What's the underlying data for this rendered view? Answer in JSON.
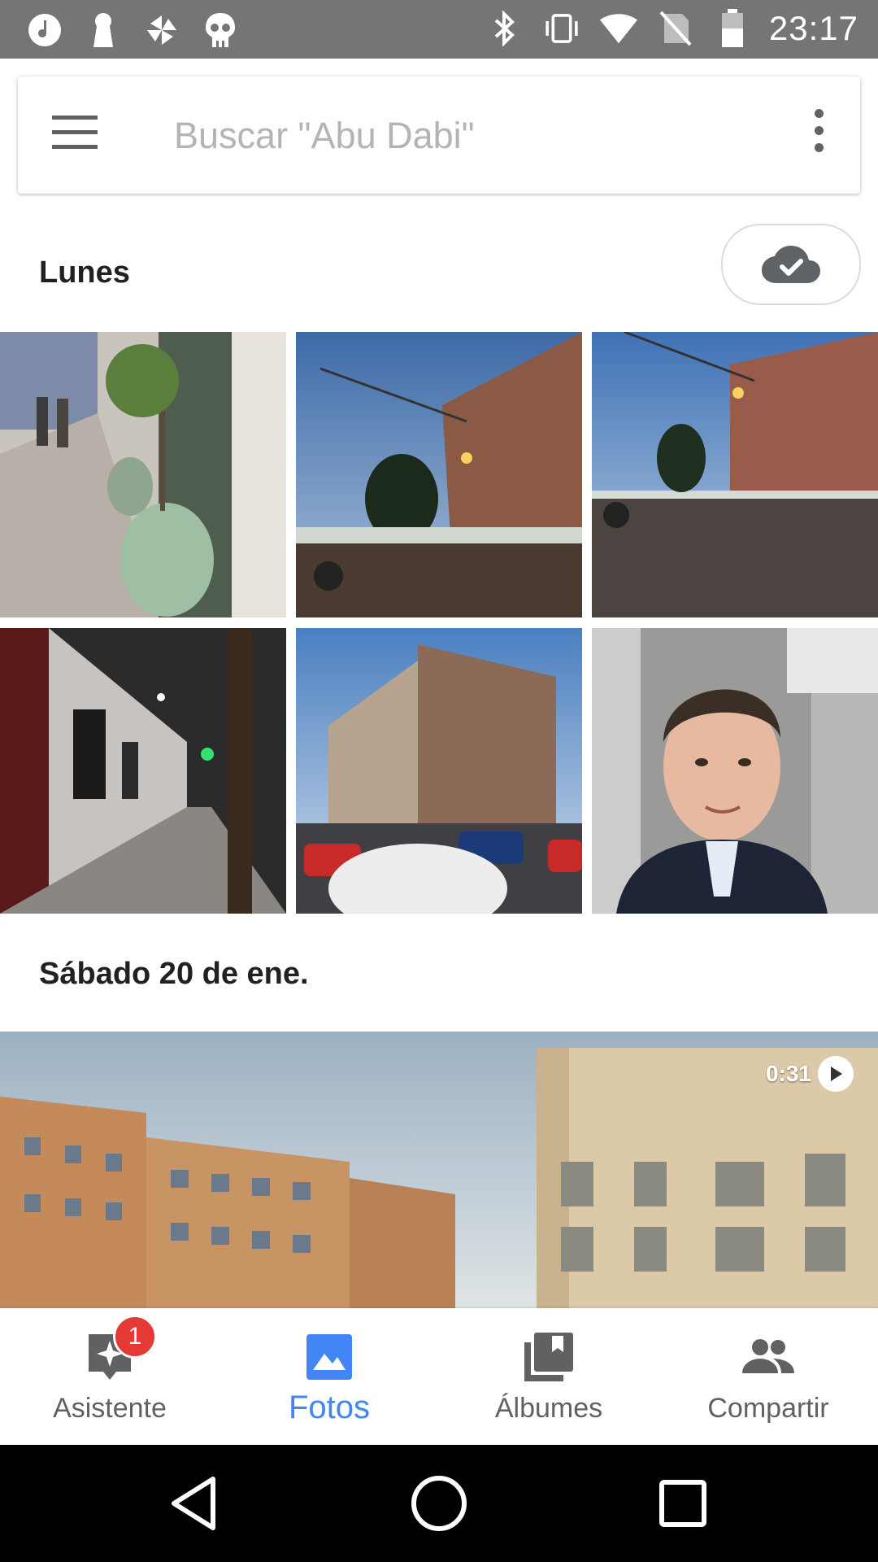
{
  "status_bar": {
    "time": "23:17",
    "left_icons": [
      "music-icon",
      "keyhole-icon",
      "pinwheel-icon",
      "skull-icon"
    ],
    "right_icons": [
      "bluetooth-icon",
      "vibrate-icon",
      "wifi-icon",
      "no-sim-icon",
      "battery-icon"
    ]
  },
  "search": {
    "placeholder": "Buscar \"Abu Dabi\""
  },
  "sections": [
    {
      "title": "Lunes"
    },
    {
      "title": "Sábado 20 de ene."
    }
  ],
  "video": {
    "duration": "0:31"
  },
  "bottom_nav": {
    "items": [
      {
        "label": "Asistente",
        "icon": "assistant-icon",
        "badge": "1",
        "active": false
      },
      {
        "label": "Fotos",
        "icon": "photo-icon",
        "active": true
      },
      {
        "label": "Álbumes",
        "icon": "albums-icon",
        "active": false
      },
      {
        "label": "Compartir",
        "icon": "people-icon",
        "active": false
      }
    ]
  },
  "colors": {
    "accent": "#4285f4",
    "status_bar": "#757575",
    "badge": "#e53935"
  }
}
